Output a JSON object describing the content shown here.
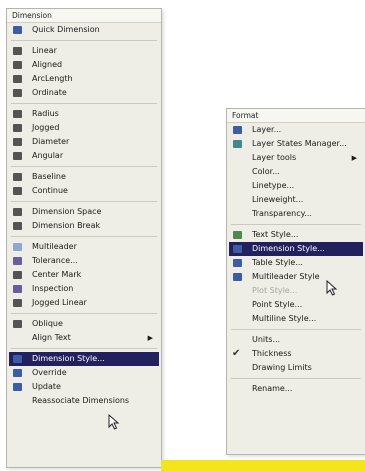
{
  "dimension_menu": {
    "title": "Dimension",
    "groups": [
      [
        {
          "label": "Quick Dimension",
          "icon": "quick-dimension-icon"
        }
      ],
      [
        {
          "label": "Linear",
          "icon": "linear-icon"
        },
        {
          "label": "Aligned",
          "icon": "aligned-icon"
        },
        {
          "label": "ArcLength",
          "icon": "arc-length-icon"
        },
        {
          "label": "Ordinate",
          "icon": "ordinate-icon"
        }
      ],
      [
        {
          "label": "Radius",
          "icon": "radius-icon"
        },
        {
          "label": "Jogged",
          "icon": "jogged-icon"
        },
        {
          "label": "Diameter",
          "icon": "diameter-icon"
        },
        {
          "label": "Angular",
          "icon": "angular-icon"
        }
      ],
      [
        {
          "label": "Baseline",
          "icon": "baseline-icon"
        },
        {
          "label": "Continue",
          "icon": "continue-icon"
        }
      ],
      [
        {
          "label": "Dimension Space",
          "icon": "dimension-space-icon"
        },
        {
          "label": "Dimension Break",
          "icon": "dimension-break-icon"
        }
      ],
      [
        {
          "label": "Multileader",
          "icon": "multileader-icon"
        },
        {
          "label": "Tolerance...",
          "icon": "tolerance-icon"
        },
        {
          "label": "Center Mark",
          "icon": "center-mark-icon"
        },
        {
          "label": "Inspection",
          "icon": "inspection-icon"
        },
        {
          "label": "Jogged Linear",
          "icon": "jogged-linear-icon"
        }
      ],
      [
        {
          "label": "Oblique",
          "icon": "oblique-icon"
        },
        {
          "label": "Align Text",
          "icon": "",
          "submenu": true
        }
      ],
      [
        {
          "label": "Dimension Style...",
          "icon": "dimension-style-icon",
          "highlighted": true
        },
        {
          "label": "Override",
          "icon": "override-icon"
        },
        {
          "label": "Update",
          "icon": "update-icon"
        },
        {
          "label": "Reassociate Dimensions",
          "icon": ""
        }
      ]
    ]
  },
  "format_menu": {
    "title": "Format",
    "groups": [
      [
        {
          "label": "Layer...",
          "icon": "layer-icon"
        },
        {
          "label": "Layer States Manager...",
          "icon": "layer-states-icon"
        },
        {
          "label": "Layer tools",
          "icon": "",
          "submenu": true
        },
        {
          "label": "Color...",
          "icon": ""
        },
        {
          "label": "Linetype...",
          "icon": ""
        },
        {
          "label": "Lineweight...",
          "icon": ""
        },
        {
          "label": "Transparency...",
          "icon": ""
        }
      ],
      [
        {
          "label": "Text Style...",
          "icon": "text-style-icon"
        },
        {
          "label": "Dimension Style...",
          "icon": "dimension-style-icon",
          "highlighted": true
        },
        {
          "label": "Table Style...",
          "icon": "table-style-icon"
        },
        {
          "label": "Multileader Style",
          "icon": "multileader-style-icon"
        },
        {
          "label": "Plot Style...",
          "icon": "",
          "disabled": true
        },
        {
          "label": "Point Style...",
          "icon": ""
        },
        {
          "label": "Multiline Style...",
          "icon": ""
        }
      ],
      [
        {
          "label": "Units...",
          "icon": ""
        },
        {
          "label": "Thickness",
          "icon": "",
          "checked": true
        },
        {
          "label": "Drawing Limits",
          "icon": ""
        }
      ],
      [
        {
          "label": "Rename...",
          "icon": ""
        }
      ]
    ]
  },
  "colors": {
    "highlight": "#23205e",
    "menu_bg": "#eeeee6",
    "accent_bar": "#f4e41c"
  }
}
